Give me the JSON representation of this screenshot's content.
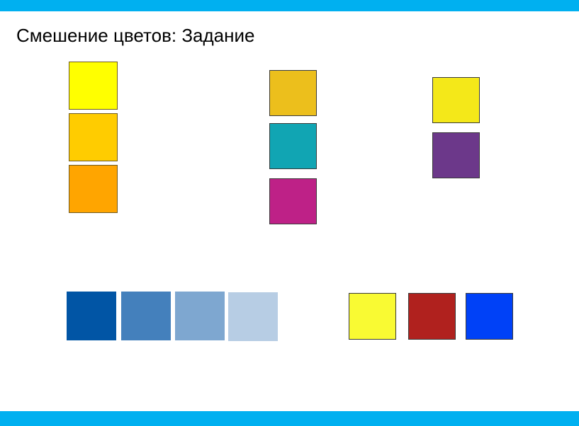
{
  "title": "Смешение цветов: Задание",
  "theme": {
    "accent_bar": "#00b0f0",
    "background": "#ffffff"
  },
  "groups": {
    "yellow_orange_column": [
      "#ffff00",
      "#ffcc00",
      "#ffa500"
    ],
    "cmy_column": [
      "#ecbf1c",
      "#11a5b3",
      "#be2187"
    ],
    "yellow_purple_pair": [
      "#f4e819",
      "#6c388a"
    ],
    "blue_gradient_row": [
      "#0155a5",
      "#4480bc",
      "#7ea7d0",
      "#b7cde4"
    ],
    "primary_row": [
      "#f9fa33",
      "#b0211e",
      "#0041f7"
    ]
  }
}
